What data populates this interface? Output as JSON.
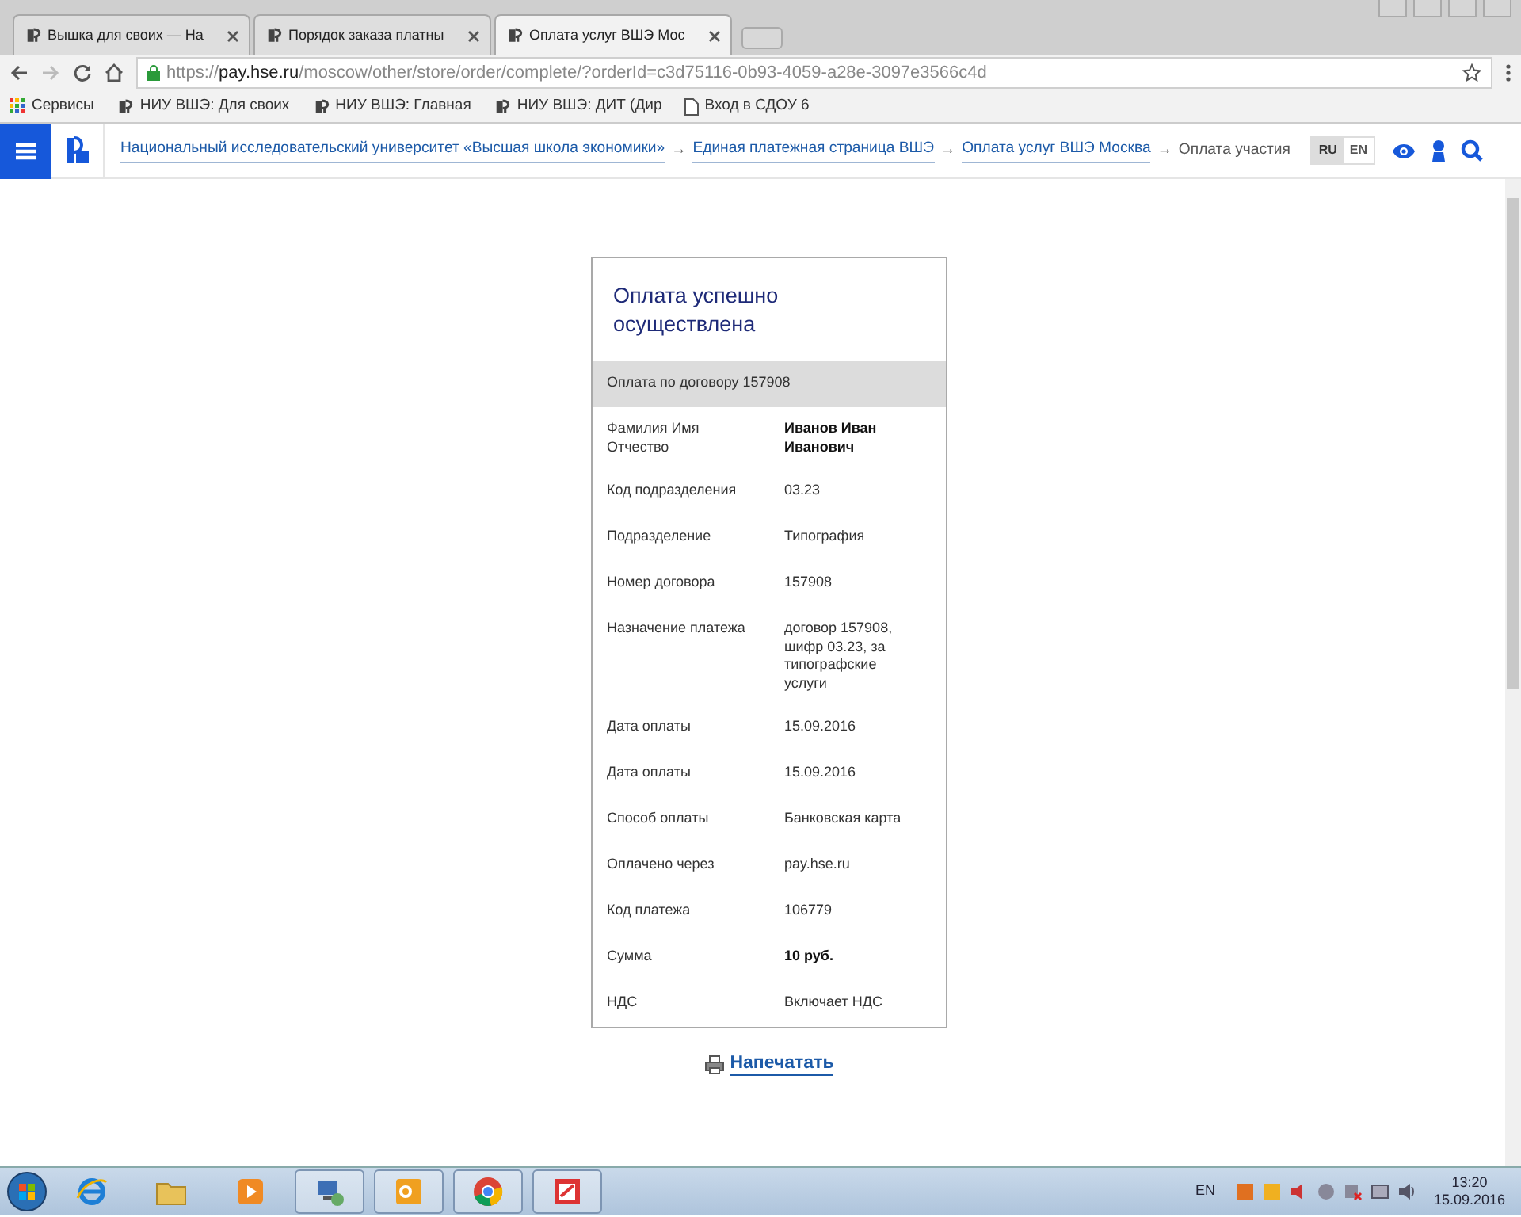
{
  "browser": {
    "tabs": [
      {
        "title": "Вышка для своих — На",
        "selected": false
      },
      {
        "title": "Порядок заказа платны",
        "selected": false
      },
      {
        "title": "Оплата услуг ВШЭ Мос",
        "selected": true
      }
    ],
    "address": {
      "scheme": "https://",
      "host": "pay.hse.ru",
      "path": "/moscow/other/store/order/complete/?orderId=c3d75116-0b93-4059-a28e-3097e3566c4d"
    },
    "bookmarks": [
      {
        "label": "Сервисы",
        "kind": "apps"
      },
      {
        "label": "НИУ ВШЭ: Для своих",
        "kind": "site"
      },
      {
        "label": "НИУ ВШЭ: Главная",
        "kind": "site"
      },
      {
        "label": "НИУ ВШЭ: ДИТ (Дир",
        "kind": "site"
      },
      {
        "label": "Вход в СДОУ 6",
        "kind": "page"
      }
    ]
  },
  "site": {
    "breadcrumbs": [
      {
        "label": "Национальный исследовательский университет «Высшая школа экономики»",
        "link": true
      },
      {
        "label": "→",
        "link": false
      },
      {
        "label": "Единая платежная страница ВШЭ",
        "link": true
      },
      {
        "label": "→",
        "link": false
      },
      {
        "label": "Оплата услуг ВШЭ Москва",
        "link": true
      },
      {
        "label": "→",
        "link": false
      },
      {
        "label": "Оплата участия",
        "link": false
      }
    ],
    "languages": [
      {
        "label": "RU",
        "selected": true
      },
      {
        "label": "EN",
        "selected": false
      }
    ]
  },
  "receipt": {
    "title": "Оплата успешно осуществлена",
    "subtitle": "Оплата по договору 157908",
    "rows": [
      {
        "label": "Фамилия Имя Отчество",
        "value": "Иванов Иван Иванович",
        "bold": true
      },
      {
        "label": "Код подразделения",
        "value": "03.23",
        "bold": false
      },
      {
        "label": "Подразделение",
        "value": "Типография",
        "bold": false
      },
      {
        "label": "Номер договора",
        "value": "157908",
        "bold": false
      },
      {
        "label": "Назначение платежа",
        "value": "договор 157908, шифр 03.23, за типографские услуги",
        "bold": false
      },
      {
        "label": "Дата оплаты",
        "value": "15.09.2016",
        "bold": false
      },
      {
        "label": "Дата оплаты",
        "value": "15.09.2016",
        "bold": false
      },
      {
        "label": "Способ оплаты",
        "value": "Банковская карта",
        "bold": false
      },
      {
        "label": "Оплачено через",
        "value": "pay.hse.ru",
        "bold": false
      },
      {
        "label": "Код платежа",
        "value": "106779",
        "bold": false
      },
      {
        "label": "Сумма",
        "value": "10 руб.",
        "bold": true
      },
      {
        "label": "НДС",
        "value": "Включает НДС",
        "bold": false
      }
    ],
    "print_link": "Напечатать"
  },
  "taskbar": {
    "apps": [
      {
        "kind": "ie",
        "open": false
      },
      {
        "kind": "folder",
        "open": false
      },
      {
        "kind": "media",
        "open": false
      },
      {
        "kind": "network",
        "open": true
      },
      {
        "kind": "outlook",
        "open": true
      },
      {
        "kind": "chrome",
        "open": true
      },
      {
        "kind": "pdf",
        "open": true
      }
    ],
    "language": "EN",
    "time": "13:20",
    "date": "15.09.2016"
  }
}
